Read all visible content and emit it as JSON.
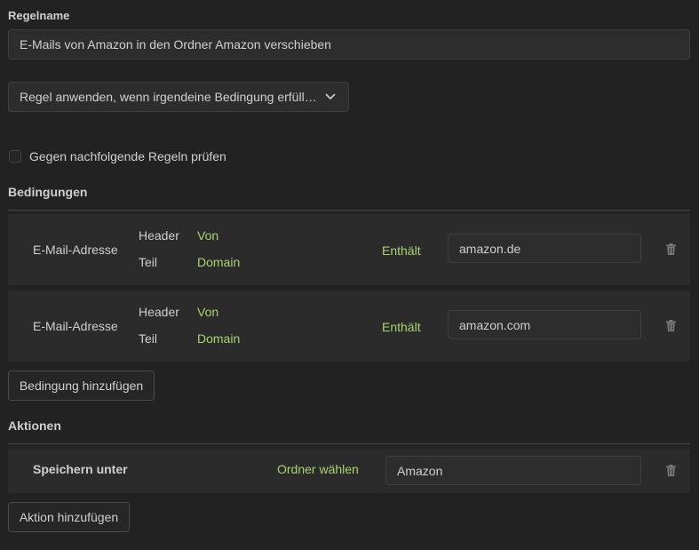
{
  "rule_name": {
    "label": "Regelname",
    "value": "E-Mails von Amazon in den Ordner Amazon verschieben"
  },
  "apply_dropdown": {
    "selected": "Regel anwenden, wenn irgendeine Bedingung erfüll…"
  },
  "continue_checkbox": {
    "label": "Gegen nachfolgende Regeln prüfen",
    "checked": false
  },
  "conditions": {
    "heading": "Bedingungen",
    "items": [
      {
        "type": "E-Mail-Adresse",
        "header_label": "Header",
        "header_value": "Von",
        "part_label": "Teil",
        "part_value": "Domain",
        "operator": "Enthält",
        "value": "amazon.de"
      },
      {
        "type": "E-Mail-Adresse",
        "header_label": "Header",
        "header_value": "Von",
        "part_label": "Teil",
        "part_value": "Domain",
        "operator": "Enthält",
        "value": "amazon.com"
      }
    ],
    "add_button": "Bedingung hinzufügen"
  },
  "actions": {
    "heading": "Aktionen",
    "items": [
      {
        "type": "Speichern unter",
        "selector": "Ordner wählen",
        "value": "Amazon"
      }
    ],
    "add_button": "Aktion hinzufügen"
  },
  "colors": {
    "background": "#222222",
    "card": "#2b2b2b",
    "accent_green": "#a8d46f",
    "text": "#cfcfcf"
  }
}
